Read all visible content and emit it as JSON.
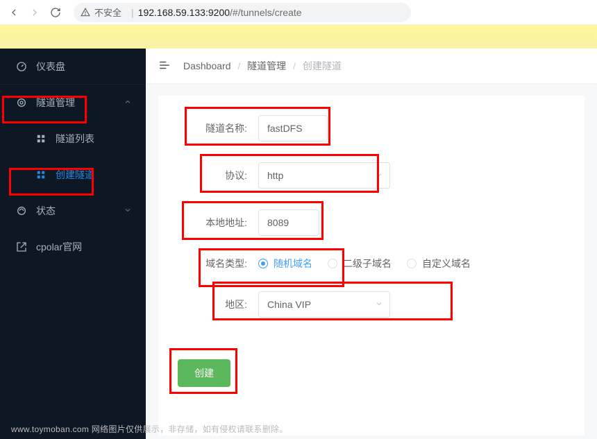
{
  "browser": {
    "insecure_label": "不安全",
    "host": "192.168.59.133",
    "port": "9200",
    "path": "/#/tunnels/create"
  },
  "sidebar": {
    "items": [
      {
        "label": "仪表盘",
        "icon": "dashboard-icon"
      },
      {
        "label": "隧道管理",
        "icon": "tunnel-icon",
        "expanded": true
      },
      {
        "label": "状态",
        "icon": "status-icon"
      },
      {
        "label": "cpolar官网",
        "icon": "external-icon"
      }
    ],
    "sub": [
      {
        "label": "隧道列表"
      },
      {
        "label": "创建隧道",
        "active": true
      }
    ]
  },
  "breadcrumb": {
    "items": [
      "Dashboard",
      "隧道管理",
      "创建隧道"
    ]
  },
  "form": {
    "name_label": "隧道名称:",
    "name_value": "fastDFS",
    "protocol_label": "协议:",
    "protocol_value": "http",
    "local_addr_label": "本地地址:",
    "local_addr_value": "8089",
    "domain_type_label": "域名类型:",
    "domain_options": [
      "随机域名",
      "二级子域名",
      "自定义域名"
    ],
    "domain_selected": "随机域名",
    "region_label": "地区:",
    "region_value": "China VIP",
    "submit_label": "创建"
  },
  "footer": "www.toymoban.com 网络图片仅供展示，非存储，如有侵权请联系删除。"
}
